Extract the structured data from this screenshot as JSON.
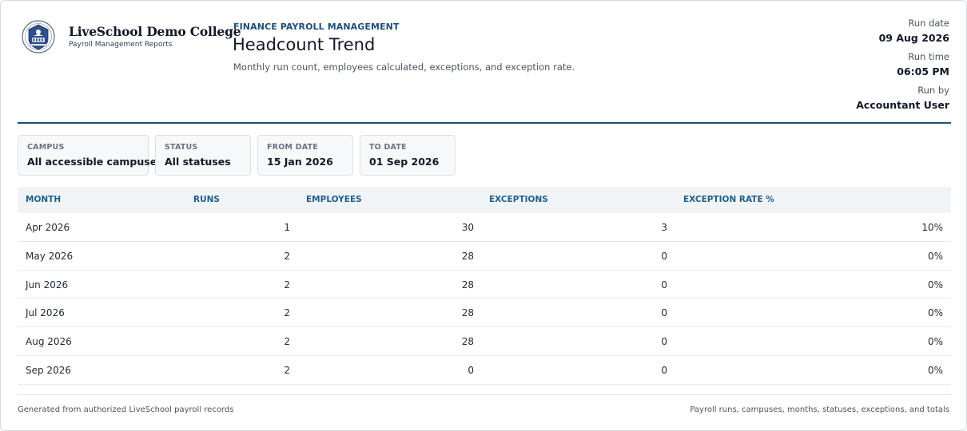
{
  "brand": {
    "name": "LiveSchool Demo College",
    "subtitle": "Payroll Management Reports",
    "logo_icon": "college-crest-icon"
  },
  "report": {
    "eyebrow": "FINANCE PAYROLL MANAGEMENT",
    "title": "Headcount Trend",
    "description": "Monthly run count, employees calculated, exceptions, and exception rate."
  },
  "meta": {
    "run_date_label": "Run date",
    "run_date": "09 Aug 2026",
    "run_time_label": "Run time",
    "run_time": "06:05 PM",
    "run_by_label": "Run by",
    "run_by": "Accountant User"
  },
  "filters": [
    {
      "label": "CAMPUS",
      "value": "All accessible campuses"
    },
    {
      "label": "STATUS",
      "value": "All statuses"
    },
    {
      "label": "FROM DATE",
      "value": "15 Jan 2026"
    },
    {
      "label": "TO DATE",
      "value": "01 Sep 2026"
    }
  ],
  "table": {
    "headers": [
      "MONTH",
      "RUNS",
      "EMPLOYEES",
      "EXCEPTIONS",
      "EXCEPTION RATE %"
    ],
    "rows": [
      [
        "Apr 2026",
        "1",
        "30",
        "3",
        "10%"
      ],
      [
        "May 2026",
        "2",
        "28",
        "0",
        "0%"
      ],
      [
        "Jun 2026",
        "2",
        "28",
        "0",
        "0%"
      ],
      [
        "Jul 2026",
        "2",
        "28",
        "0",
        "0%"
      ],
      [
        "Aug 2026",
        "2",
        "28",
        "0",
        "0%"
      ],
      [
        "Sep 2026",
        "2",
        "0",
        "0",
        "0%"
      ]
    ]
  },
  "footer": {
    "left": "Generated from authorized LiveSchool payroll records",
    "right": "Payroll runs, campuses, months, statuses, exceptions, and totals"
  },
  "colors": {
    "accent": "#1f4e79",
    "header_text": "#1f5f8b",
    "divider": "#1f4e6e"
  }
}
